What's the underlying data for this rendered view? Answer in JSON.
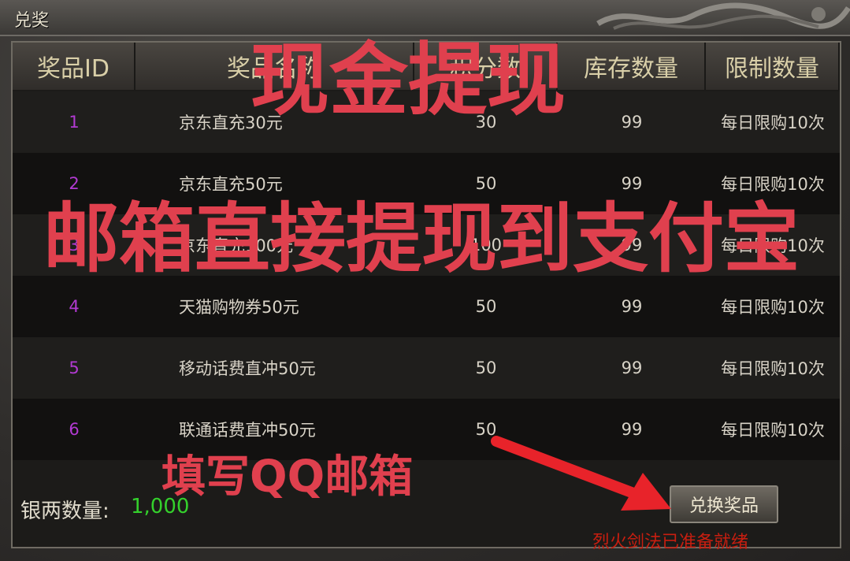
{
  "window": {
    "title": "兑奖"
  },
  "table": {
    "headers": [
      "奖品ID",
      "奖品名称",
      "积分数",
      "库存数量",
      "限制数量"
    ],
    "rows": [
      {
        "id": "1",
        "name": "京东直充30元",
        "points": "30",
        "stock": "99",
        "limit": "每日限购10次"
      },
      {
        "id": "2",
        "name": "京东直充50元",
        "points": "50",
        "stock": "99",
        "limit": "每日限购10次"
      },
      {
        "id": "3",
        "name": "京东直充100元",
        "points": "100",
        "stock": "99",
        "limit": "每日限购10次"
      },
      {
        "id": "4",
        "name": "天猫购物券50元",
        "points": "50",
        "stock": "99",
        "limit": "每日限购10次"
      },
      {
        "id": "5",
        "name": "移动话费直冲50元",
        "points": "50",
        "stock": "99",
        "limit": "每日限购10次"
      },
      {
        "id": "6",
        "name": "联通话费直冲50元",
        "points": "50",
        "stock": "99",
        "limit": "每日限购10次"
      }
    ]
  },
  "footer": {
    "silver_label": "银两数量:",
    "silver_value": "1,000",
    "exchange_button": "兑换奖品",
    "status_text": "烈火剑法已准备就绪"
  },
  "overlays": {
    "headline": "现金提现",
    "subline": "邮箱直接提现到支付宝",
    "hint": "填写QQ邮箱"
  },
  "colors": {
    "overlay_text": "#e0404e",
    "arrow": "#e8232a",
    "id_text": "#b23ad2",
    "silver_value": "#34d02c",
    "status_text": "#c81e10"
  },
  "icons": {
    "decoration": "dragon-ornament-icon",
    "pointer": "arrow-icon"
  }
}
